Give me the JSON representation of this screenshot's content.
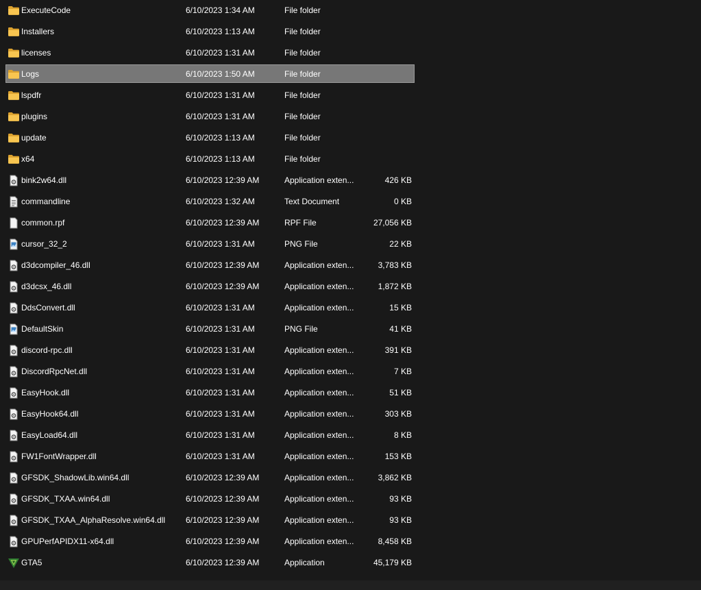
{
  "colors": {
    "background": "#191919",
    "selected_row": "#777777",
    "folder": "#f8c550",
    "text": "#ffffff"
  },
  "files": [
    {
      "name": "ExecuteCode",
      "date": "6/10/2023 1:34 AM",
      "type": "File folder",
      "size": "",
      "icon": "folder"
    },
    {
      "name": "Installers",
      "date": "6/10/2023 1:13 AM",
      "type": "File folder",
      "size": "",
      "icon": "folder"
    },
    {
      "name": "licenses",
      "date": "6/10/2023 1:31 AM",
      "type": "File folder",
      "size": "",
      "icon": "folder"
    },
    {
      "name": "Logs",
      "date": "6/10/2023 1:50 AM",
      "type": "File folder",
      "size": "",
      "icon": "folder",
      "selected": true
    },
    {
      "name": "lspdfr",
      "date": "6/10/2023 1:31 AM",
      "type": "File folder",
      "size": "",
      "icon": "folder"
    },
    {
      "name": "plugins",
      "date": "6/10/2023 1:31 AM",
      "type": "File folder",
      "size": "",
      "icon": "folder"
    },
    {
      "name": "update",
      "date": "6/10/2023 1:13 AM",
      "type": "File folder",
      "size": "",
      "icon": "folder"
    },
    {
      "name": "x64",
      "date": "6/10/2023 1:13 AM",
      "type": "File folder",
      "size": "",
      "icon": "folder"
    },
    {
      "name": "bink2w64.dll",
      "date": "6/10/2023 12:39 AM",
      "type": "Application exten...",
      "size": "426 KB",
      "icon": "dll"
    },
    {
      "name": "commandline",
      "date": "6/10/2023 1:32 AM",
      "type": "Text Document",
      "size": "0 KB",
      "icon": "text"
    },
    {
      "name": "common.rpf",
      "date": "6/10/2023 12:39 AM",
      "type": "RPF File",
      "size": "27,056 KB",
      "icon": "blank"
    },
    {
      "name": "cursor_32_2",
      "date": "6/10/2023 1:31 AM",
      "type": "PNG File",
      "size": "22 KB",
      "icon": "image"
    },
    {
      "name": "d3dcompiler_46.dll",
      "date": "6/10/2023 12:39 AM",
      "type": "Application exten...",
      "size": "3,783 KB",
      "icon": "dll"
    },
    {
      "name": "d3dcsx_46.dll",
      "date": "6/10/2023 12:39 AM",
      "type": "Application exten...",
      "size": "1,872 KB",
      "icon": "dll"
    },
    {
      "name": "DdsConvert.dll",
      "date": "6/10/2023 1:31 AM",
      "type": "Application exten...",
      "size": "15 KB",
      "icon": "dll"
    },
    {
      "name": "DefaultSkin",
      "date": "6/10/2023 1:31 AM",
      "type": "PNG File",
      "size": "41 KB",
      "icon": "image"
    },
    {
      "name": "discord-rpc.dll",
      "date": "6/10/2023 1:31 AM",
      "type": "Application exten...",
      "size": "391 KB",
      "icon": "dll"
    },
    {
      "name": "DiscordRpcNet.dll",
      "date": "6/10/2023 1:31 AM",
      "type": "Application exten...",
      "size": "7 KB",
      "icon": "dll"
    },
    {
      "name": "EasyHook.dll",
      "date": "6/10/2023 1:31 AM",
      "type": "Application exten...",
      "size": "51 KB",
      "icon": "dll"
    },
    {
      "name": "EasyHook64.dll",
      "date": "6/10/2023 1:31 AM",
      "type": "Application exten...",
      "size": "303 KB",
      "icon": "dll"
    },
    {
      "name": "EasyLoad64.dll",
      "date": "6/10/2023 1:31 AM",
      "type": "Application exten...",
      "size": "8 KB",
      "icon": "dll"
    },
    {
      "name": "FW1FontWrapper.dll",
      "date": "6/10/2023 1:31 AM",
      "type": "Application exten...",
      "size": "153 KB",
      "icon": "dll"
    },
    {
      "name": "GFSDK_ShadowLib.win64.dll",
      "date": "6/10/2023 12:39 AM",
      "type": "Application exten...",
      "size": "3,862 KB",
      "icon": "dll"
    },
    {
      "name": "GFSDK_TXAA.win64.dll",
      "date": "6/10/2023 12:39 AM",
      "type": "Application exten...",
      "size": "93 KB",
      "icon": "dll"
    },
    {
      "name": "GFSDK_TXAA_AlphaResolve.win64.dll",
      "date": "6/10/2023 12:39 AM",
      "type": "Application exten...",
      "size": "93 KB",
      "icon": "dll"
    },
    {
      "name": "GPUPerfAPIDX11-x64.dll",
      "date": "6/10/2023 12:39 AM",
      "type": "Application exten...",
      "size": "8,458 KB",
      "icon": "dll"
    },
    {
      "name": "GTA5",
      "date": "6/10/2023 12:39 AM",
      "type": "Application",
      "size": "45,179 KB",
      "icon": "app"
    }
  ]
}
